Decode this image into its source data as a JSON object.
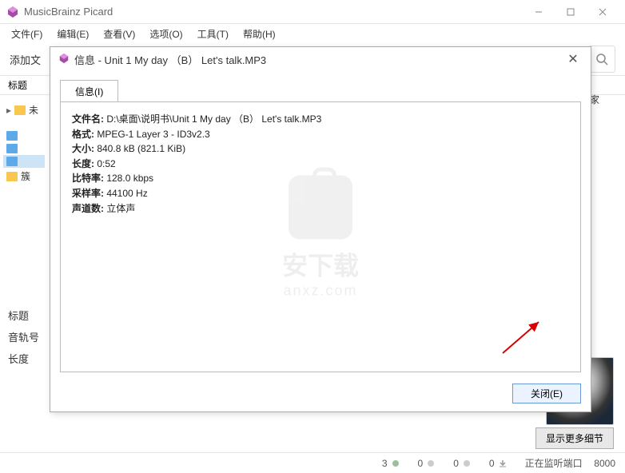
{
  "app": {
    "title": "MusicBrainz Picard"
  },
  "menu": {
    "file": "文件(F)",
    "edit": "编辑(E)",
    "view": "查看(V)",
    "options": "选项(O)",
    "tools": "工具(T)",
    "help": "帮助(H)"
  },
  "toolbar": {
    "add_files": "添加文"
  },
  "tree": {
    "header": "标题",
    "item1_prefix": "未",
    "item2_prefix": "簇"
  },
  "right_col_header": "家",
  "panel": {
    "title": "标题",
    "track": "音轨号",
    "length": "长度"
  },
  "buttons": {
    "show_details": "显示更多细节",
    "close": "关闭(E)"
  },
  "status": {
    "n1": "3",
    "n2": "0",
    "n3": "0",
    "n4": "0",
    "listening": "正在监听端口",
    "port": "8000"
  },
  "dialog": {
    "title": "信息 - Unit 1 My day （B） Let's talk.MP3",
    "tab": "信息(I)",
    "info": {
      "filename_label": "文件名:",
      "filename_value": " D:\\桌面\\说明书\\Unit 1 My day （B） Let's talk.MP3",
      "format_label": "格式:",
      "format_value": " MPEG-1 Layer 3 - ID3v2.3",
      "size_label": "大小:",
      "size_value": " 840.8 kB (821.1 KiB)",
      "length_label": "长度:",
      "length_value": " 0:52",
      "bitrate_label": "比特率:",
      "bitrate_value": " 128.0 kbps",
      "samplerate_label": "采样率:",
      "samplerate_value": " 44100 Hz",
      "channels_label": "声道数:",
      "channels_value": " 立体声"
    }
  },
  "watermark": {
    "l1": "安下载",
    "l2": "anxz.com"
  }
}
